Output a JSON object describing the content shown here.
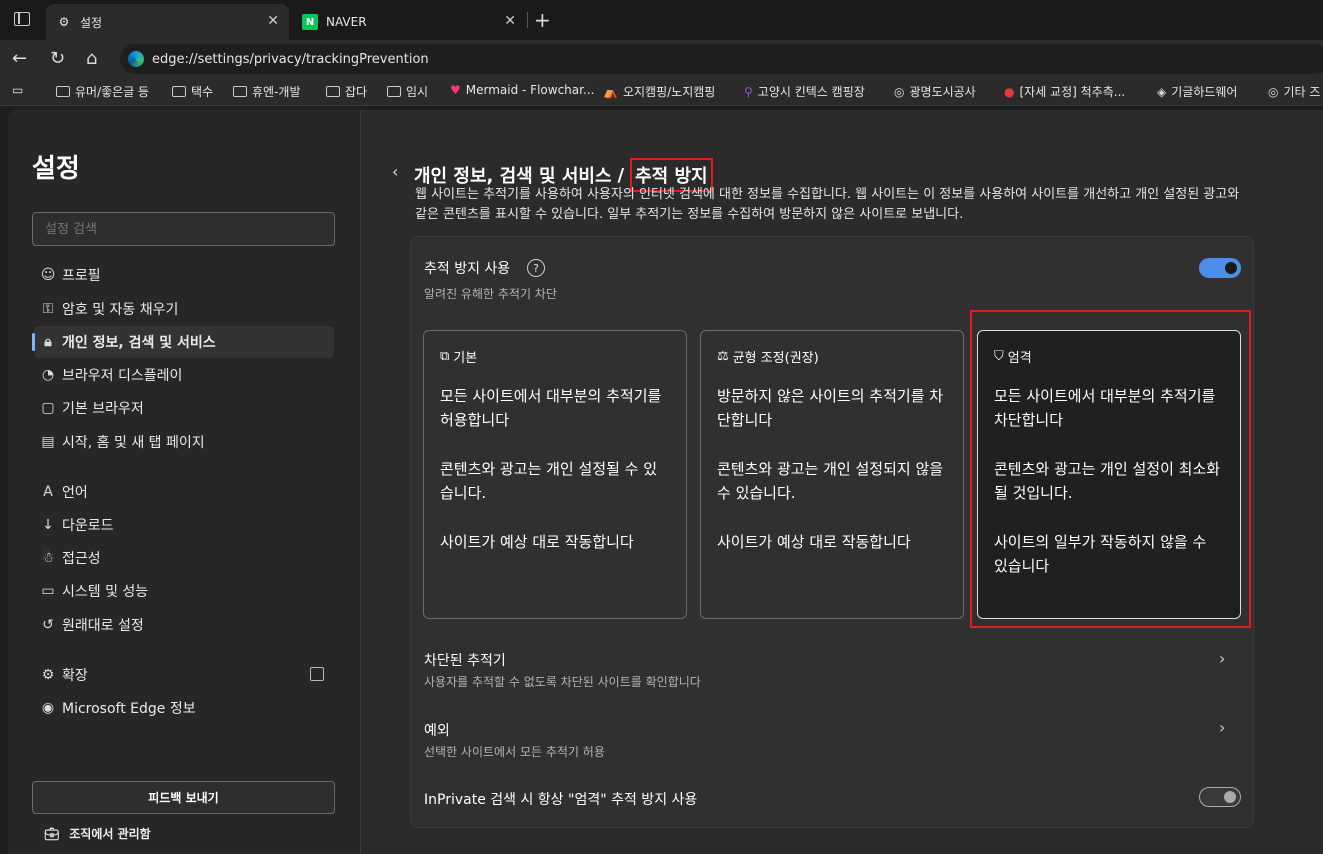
{
  "tabs": [
    {
      "label": "설정",
      "icon": "gear-icon"
    },
    {
      "label": "NAVER",
      "icon": "naver-icon"
    }
  ],
  "url": "edge://settings/privacy/trackingPrevention",
  "bookmarks": [
    "유머/좋은글 등",
    "택수",
    "휴엔-개발",
    "잡다",
    "임시",
    "Mermaid - Flowchar...",
    "오지캠핑/노지캠핑",
    "고양시 킨텍스 캠핑장",
    "광명도시공사",
    "[자세 교정] 척추측...",
    "기글하드웨어",
    "기타 즈"
  ],
  "sidebar": {
    "title": "설정",
    "search_placeholder": "설정 검색",
    "items": [
      {
        "label": "프로필",
        "icon": "profile-icon"
      },
      {
        "label": "암호 및 자동 채우기",
        "icon": "key-icon"
      },
      {
        "label": "개인 정보, 검색 및 서비스",
        "icon": "lock-icon",
        "selected": true
      },
      {
        "label": "브라우저 디스플레이",
        "icon": "palette-icon"
      },
      {
        "label": "기본 브라우저",
        "icon": "browser-icon"
      },
      {
        "label": "시작, 홈 및 새 탭 페이지",
        "icon": "home-icon"
      },
      {
        "label": "언어",
        "icon": "language-icon"
      },
      {
        "label": "다운로드",
        "icon": "download-icon"
      },
      {
        "label": "접근성",
        "icon": "accessibility-icon"
      },
      {
        "label": "시스템 및 성능",
        "icon": "laptop-icon"
      },
      {
        "label": "원래대로 설정",
        "icon": "reset-icon"
      },
      {
        "label": "확장",
        "icon": "extension-icon"
      },
      {
        "label": "Microsoft Edge 정보",
        "icon": "edge-icon"
      }
    ],
    "feedback": "피드백 보내기",
    "org": "조직에서 관리함"
  },
  "main": {
    "breadcrumb_parent": "개인 정보, 검색 및 서비스",
    "breadcrumb_sep": "/",
    "title": "추적 방지",
    "description": "웹 사이트는 추적기를 사용하여 사용자의 인터넷 검색에 대한 정보를 수집합니다. 웹 사이트는 이 정보를 사용하여 사이트를 개선하고 개인 설정된 광고와 같은 콘텐츠를 표시할 수 있습니다. 일부 추적기는 정보를 수집하여 방문하지 않은 사이트로 보냅니다.",
    "enable_label": "추적 방지 사용",
    "enable_sub": "알려진 유해한 추적기 차단",
    "enable_on": true,
    "options": [
      {
        "title": "기본",
        "icon": "shield-basic-icon",
        "lines": [
          "모든 사이트에서 대부분의 추적기를 허용합니다",
          "콘텐츠와 광고는 개인 설정될 수 있습니다.",
          "사이트가 예상 대로 작동합니다"
        ]
      },
      {
        "title": "균형 조정(권장)",
        "icon": "scale-icon",
        "lines": [
          "방문하지 않은 사이트의 추적기를 차단합니다",
          "콘텐츠와 광고는 개인 설정되지 않을 수 있습니다.",
          "사이트가 예상 대로 작동합니다"
        ]
      },
      {
        "title": "엄격",
        "icon": "shield-icon",
        "lines": [
          "모든 사이트에서 대부분의 추적기를 차단합니다",
          "콘텐츠와 광고는 개인 설정이 최소화될 것입니다.",
          "사이트의 일부가 작동하지 않을 수 있습니다"
        ],
        "selected": true
      }
    ],
    "blocked_title": "차단된 추적기",
    "blocked_sub": "사용자를 추적할 수 없도록 차단된 사이트를 확인합니다",
    "exceptions_title": "예외",
    "exceptions_sub": "선택한 사이트에서 모든 추적기 허용",
    "inprivate_label": "InPrivate 검색 시 항상 \"엄격\" 추적 방지 사용",
    "inprivate_on": false
  }
}
